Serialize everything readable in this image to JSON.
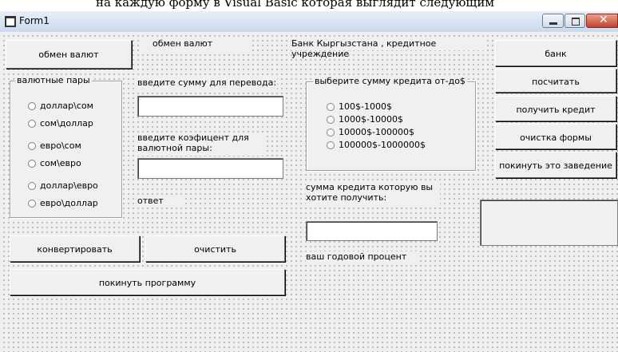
{
  "header_strip": "на каждую форму в Visual Basic которая выглядит следующим",
  "window": {
    "title": "Form1",
    "close_glyph": "✕"
  },
  "buttons": {
    "exchange": "обмен валют",
    "convert": "конвертировать",
    "clear": "очистить",
    "exit_program": "покинуть программу",
    "bank": "банк",
    "calculate": "посчитать",
    "get_credit": "получить кредит",
    "clear_form": "очистка формы",
    "leave": "покинуть это заведение"
  },
  "labels": {
    "exchange_header": "обмен валют",
    "bank_header": "Банк Кыргызстана , кредитное учреждение",
    "enter_amount": "введите сумму для перевода:",
    "enter_coef": "введите коэфицент для валютной пары:",
    "answer": "ответ",
    "credit_amount": "сумма кредита которую вы хотите получить:",
    "annual_percent": "ваш годовой процент"
  },
  "currency_frame": {
    "title": "валютные пары",
    "options": [
      "доллар\\сом",
      "сом\\доллар",
      "евро\\сом",
      "сом\\евро",
      "доллар\\евро",
      "евро\\доллар"
    ]
  },
  "credit_frame": {
    "title": "выберите сумму кредита от-до$",
    "options": [
      "100$-1000$",
      "1000$-10000$",
      "10000$-100000$",
      "100000$-1000000$"
    ]
  },
  "inputs": {
    "amount": "",
    "coef": "",
    "credit": ""
  },
  "colors": {
    "form_bg": "#f0f0f0",
    "titlebar": "#c9daee",
    "close": "#c7402c"
  },
  "icons": {
    "form": "form-icon",
    "minimize": "minimize-icon",
    "maximize": "maximize-icon",
    "close": "close-icon"
  }
}
